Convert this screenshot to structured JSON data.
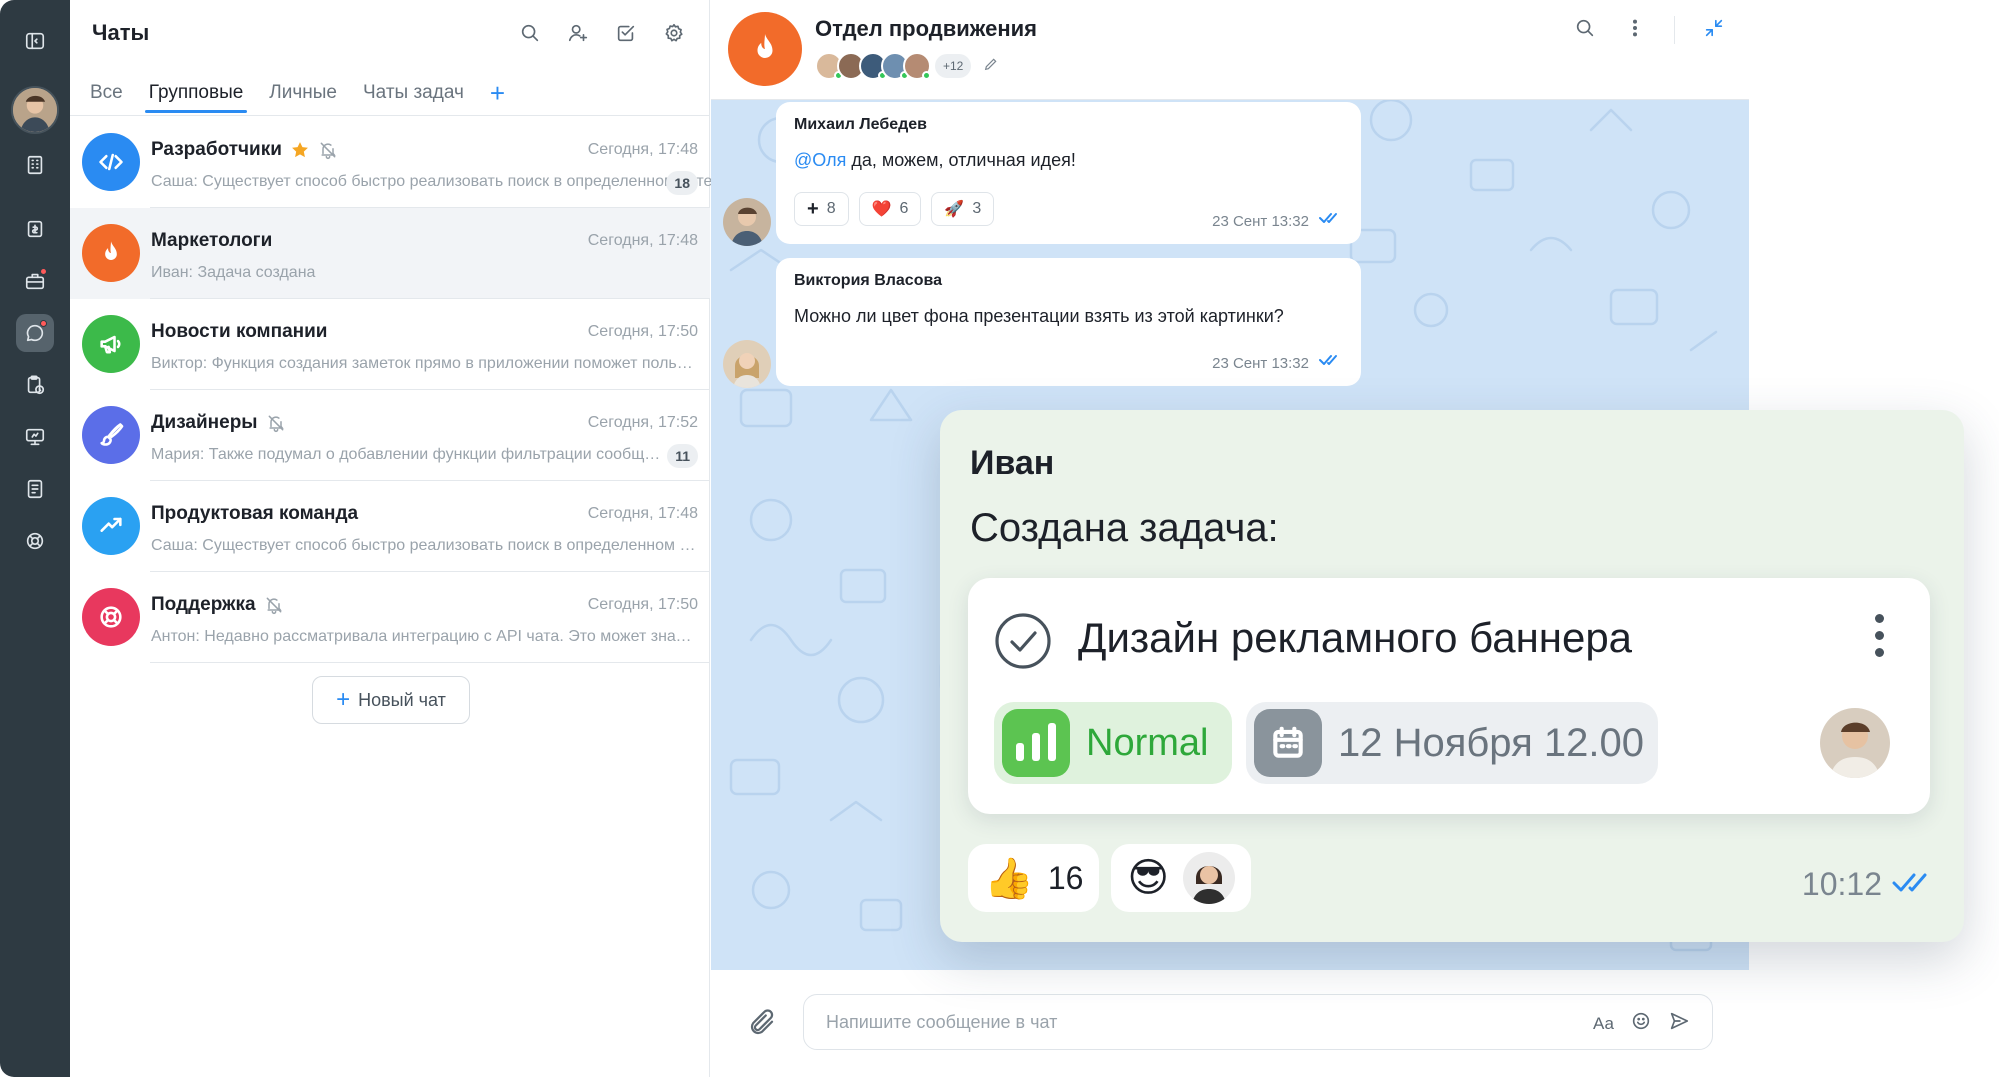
{
  "rail": {
    "items": [
      {
        "icon": "collapse-panel-icon"
      },
      {
        "icon": "avatar"
      },
      {
        "icon": "building-icon"
      },
      {
        "icon": "wallet-icon"
      },
      {
        "icon": "briefcase-icon",
        "badge": true
      },
      {
        "icon": "chat-icon",
        "active": true,
        "badge": true
      },
      {
        "icon": "clipboard-clock-icon"
      },
      {
        "icon": "monitor-icon"
      },
      {
        "icon": "document-icon"
      },
      {
        "icon": "lifebuoy-icon"
      }
    ]
  },
  "chat_list": {
    "title": "Чаты",
    "tabs": [
      {
        "label": "Все",
        "active": false
      },
      {
        "label": "Групповые",
        "active": true
      },
      {
        "label": "Личные",
        "active": false
      },
      {
        "label": "Чаты задач",
        "active": false
      }
    ],
    "add_tab": "+",
    "chats": [
      {
        "name": "Разработчики",
        "time": "Сегодня, 17:48",
        "preview": "Саша: Существует способ быстро реализовать поиск в определенном чате",
        "badge": "18",
        "color": "#2a8bf2",
        "icon": "code-icon",
        "starred": true,
        "muted": true
      },
      {
        "name": "Маркетологи",
        "time": "Сегодня, 17:48",
        "preview": "Иван: Задача создана",
        "badge": "",
        "color": "#f26b2a",
        "icon": "fire-icon",
        "starred": false,
        "muted": false
      },
      {
        "name": "Новости компании",
        "time": "Сегодня, 17:50",
        "preview": "Виктор: Функция создания заметок прямо в приложении поможет пользователям",
        "badge": "",
        "color": "#3cba4a",
        "icon": "megaphone-icon",
        "starred": false,
        "muted": false
      },
      {
        "name": "Дизайнеры",
        "time": "Сегодня, 17:52",
        "preview": "Мария: Также подумал о добавлении функции фильтрации сообщений",
        "badge": "11",
        "color": "#5b6ee8",
        "icon": "brush-icon",
        "starred": false,
        "muted": true
      },
      {
        "name": "Продуктовая команда",
        "time": "Сегодня, 17:48",
        "preview": "Саша: Существует способ быстро реализовать поиск в определенном чате",
        "badge": "",
        "color": "#2aa1f2",
        "icon": "trend-icon",
        "starred": false,
        "muted": false
      },
      {
        "name": "Поддержка",
        "time": "Сегодня, 17:50",
        "preview": "Антон: Недавно рассматривала интеграцию с API чата. Это может значительно",
        "badge": "",
        "color": "#e8385e",
        "icon": "lifebuoy-icon",
        "starred": false,
        "muted": true
      }
    ],
    "new_chat_label": "Новый чат"
  },
  "conversation": {
    "title": "Отдел продвижения",
    "members_more": "+12",
    "member_colors": [
      "#d9b99b",
      "#8b6a55",
      "#3d5b7a",
      "#6e8fb0",
      "#b58b73"
    ],
    "messages": [
      {
        "author": "Михаил Лебедев",
        "mention": "@Оля",
        "text": " да, можем, отличная идея!",
        "time": "23 Сент 13:32",
        "reactions": [
          {
            "emoji": "+",
            "count": "8"
          },
          {
            "emoji": "❤️",
            "count": "6"
          },
          {
            "emoji": "🚀",
            "count": "3"
          }
        ]
      },
      {
        "author": "Виктория Власова",
        "mention": "",
        "text": "Можно ли цвет фона презентации взять из этой картинки?",
        "time": "23 Сент 13:32",
        "reactions": []
      }
    ],
    "composer_placeholder": "Напишите сообщение в чат",
    "composer_font_label": "Аа"
  },
  "task_message": {
    "author": "Иван",
    "heading": "Создана задача:",
    "task_title": "Дизайн рекламного баннера",
    "priority": "Normal",
    "due": "12 Ноября 12.00",
    "reactions": [
      {
        "emoji": "👍",
        "count": "16"
      },
      {
        "emoji": "😎",
        "count": ""
      }
    ],
    "time": "10:12"
  }
}
